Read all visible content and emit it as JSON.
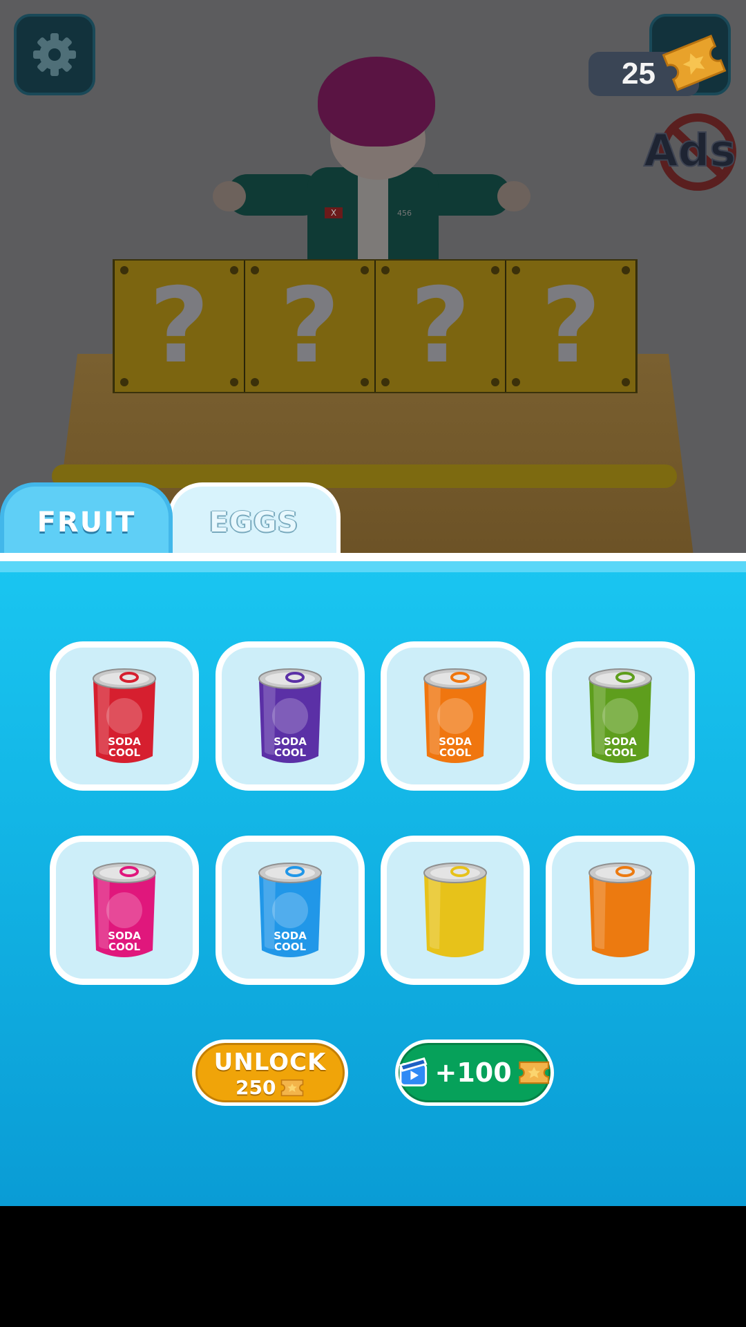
{
  "hud": {
    "currency_amount": "25",
    "settings_icon": "gear-icon",
    "shop_icon": "shop-icon",
    "no_ads_label": "Ads"
  },
  "scene": {
    "boxes": [
      "?",
      "?",
      "?",
      "?"
    ],
    "shirt_number": "456",
    "shirt_patch": "X"
  },
  "tabs": [
    {
      "label": "FRUIT",
      "selected": true
    },
    {
      "label": "EGGS",
      "selected": false
    }
  ],
  "items": [
    {
      "name": "pomegranate-soda",
      "color": "#d61f2f",
      "label": "SODA COOL"
    },
    {
      "name": "grape-soda",
      "color": "#5b30a6",
      "label": "SODA COOL"
    },
    {
      "name": "orange-soda",
      "color": "#f0760f",
      "label": "SODA COOL"
    },
    {
      "name": "pear-soda",
      "color": "#5e9e1d",
      "label": "SODA COOL"
    },
    {
      "name": "strawberry-soda",
      "color": "#e0177c",
      "label": "SODA COOL"
    },
    {
      "name": "blueberry-soda",
      "color": "#2197e8",
      "label": "SODA COOL"
    },
    {
      "name": "plain-yellow-can",
      "color": "#e7c21a",
      "label": ""
    },
    {
      "name": "plain-orange-can",
      "color": "#ec7a10",
      "label": ""
    }
  ],
  "buttons": {
    "unlock_label": "UNLOCK",
    "unlock_price": "250",
    "ad_reward": "+100",
    "ad_icon": "video-ad-icon",
    "ticket_icon": "ticket-icon"
  },
  "colors": {
    "panel": "#13b6e6",
    "unlock": "#f0a409",
    "ad": "#06a15a"
  }
}
